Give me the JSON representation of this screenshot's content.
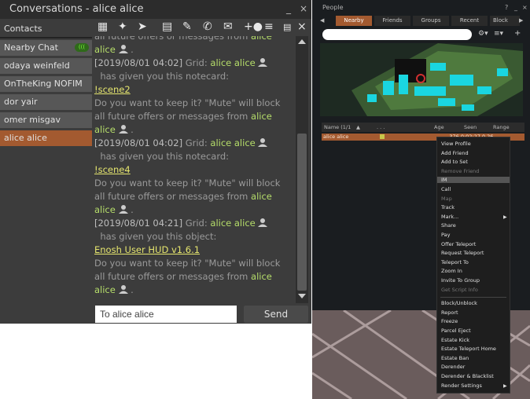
{
  "conversations": {
    "title": "Conversations - alice alice",
    "minimize": "_",
    "close": "×",
    "contacts_label": "Contacts",
    "nearby_chat_label": "Nearby Chat",
    "nearby_badge": "(((",
    "tabs": [
      "odaya weinfeld",
      "OnTheKing NOFIM",
      "dor yair",
      "omer misgav",
      "alice alice"
    ],
    "toolbar_close": "×",
    "chat": {
      "line1a": "all future offers or messages from ",
      "line2a": "alice",
      "msg1_time": "[2019/08/01 04:02]",
      "grid": "Grid:",
      "name": "alice alice",
      "given_notecard": "has given you this notecard:",
      "item1": "!scene2",
      "keep_q": "Do you want to keep it? \"Mute\" will block",
      "all_future": "all future offers or messages from ",
      "alice": "alice",
      "msg2_time": "[2019/08/01 04:02]",
      "item2": "!scene4",
      "msg3_time": "[2019/08/01 04:21]",
      "given_object": "has given you this object:",
      "item3": "Enosh User HUD v1.6.1",
      "dot": "."
    },
    "input_value": "To alice alice",
    "send_label": "Send"
  },
  "people": {
    "title": "People",
    "header_help": "?",
    "header_min": "_",
    "header_close": "×",
    "tabs": [
      "Nearby",
      "Friends",
      "Groups",
      "Recent",
      "Block"
    ],
    "columns": [
      "Name (1/1",
      ". . .",
      "Age",
      "Seen",
      "Range"
    ],
    "row_name": "alice alice",
    "row_info": "-376    0:02:27   0.26",
    "context_menu": {
      "items1": [
        "View Profile",
        "Add Friend",
        "Add to Set",
        "Remove Friend",
        "IM",
        "Call",
        "Map",
        "Track",
        "Mark...",
        "Share",
        "Pay",
        "Offer Teleport",
        "Request Teleport",
        "Teleport To",
        "Zoom In",
        "Invite To Group",
        "Get Script Info"
      ],
      "disabled1": [
        "Remove Friend",
        "Map",
        "Get Script Info"
      ],
      "highlighted": "IM",
      "items2": [
        "Block/Unblock",
        "Report",
        "Freeze",
        "Parcel Eject",
        "Estate Kick",
        "Estate Teleport Home",
        "Estate Ban",
        "Derender",
        "Derender & Blacklist",
        "Render Settings"
      ],
      "submenu_arrow": "▶"
    }
  },
  "colors": {
    "accent": "#b6de6a",
    "link": "#e6e66e",
    "selected": "#a35a30",
    "ctx_highlight": "#555555"
  }
}
